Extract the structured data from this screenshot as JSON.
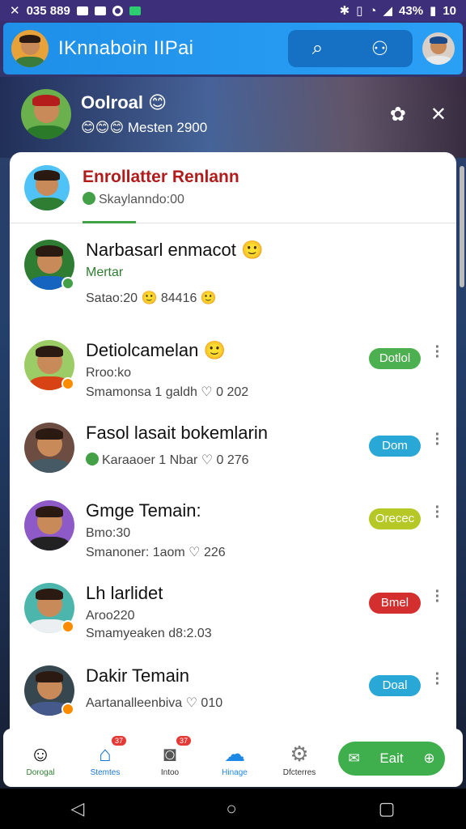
{
  "status": {
    "left_text": "035 889",
    "battery": "43%",
    "time": "10"
  },
  "appbar": {
    "title": "IKnnaboin IIPai"
  },
  "header": {
    "name": "Oolroal 😊",
    "sub": "😊😊😊 Mesten 2900"
  },
  "active": {
    "title": "Enrollatter Renlann",
    "sub": "Skaylanndo:00"
  },
  "contacts": [
    {
      "name": "Narbasarl enmacot 🙂",
      "line2": "Mertar",
      "line3": "Satao:20  🙂 84416 🙂",
      "chip": "",
      "chip_color": ""
    },
    {
      "name": "Detiolcamelan 🙂",
      "line2": "Rroo:ko",
      "line3": "Smamonsa 1 galdh ♡ 0 202",
      "chip": "Dotlol",
      "chip_color": "#4caf50"
    },
    {
      "name": "Fasol lasait bokemlarin",
      "line2": "Karaaoer 1 Nbar ♡ 0 276",
      "line3": "",
      "chip": "Dom",
      "chip_color": "#29a8d8"
    },
    {
      "name": "Gmge Temain:",
      "line2": "Bmo:30",
      "line3": "Smanoner: 1aom ♡ 226",
      "chip": "Orecec",
      "chip_color": "#b5c825"
    },
    {
      "name": "Lh larlidet",
      "line2": "Aroo220",
      "line3": "Smamyeaken d8:2.03",
      "chip": "Bmel",
      "chip_color": "#d32f2f"
    },
    {
      "name": "Dakir Temain",
      "line2": "Aartanalleenbiva ♡ 010",
      "line3": "",
      "chip": "Doal",
      "chip_color": "#29a8d8"
    }
  ],
  "bottom_nav": [
    {
      "label": "Dorogal",
      "icon": "profile-icon",
      "count": ""
    },
    {
      "label": "Stemtes",
      "icon": "home-icon",
      "count": "37"
    },
    {
      "label": "Intoo",
      "icon": "camera-icon",
      "count": "37"
    },
    {
      "label": "Hinage",
      "icon": "chat-icon",
      "count": ""
    },
    {
      "label": "Dfcterres",
      "icon": "settings-icon",
      "count": ""
    }
  ],
  "fab": {
    "label": "Eait"
  }
}
